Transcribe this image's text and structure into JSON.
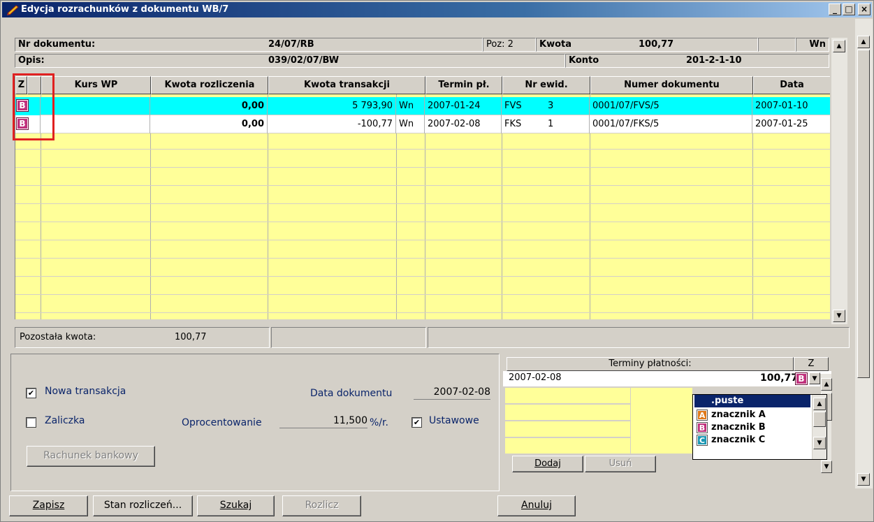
{
  "window": {
    "title": "Edycja rozrachunków z dokumentu WB/7",
    "controls": [
      "_",
      "□",
      "X"
    ]
  },
  "header": {
    "nr_label": "Nr dokumentu:",
    "nr_value": "24/07/RB",
    "poz": "Poz: 2",
    "kwota_label": "Kwota",
    "kwota_value": "100,77",
    "side": "Wn",
    "opis_label": "Opis:",
    "opis_value": "039/02/07/BW",
    "konto_label": "Konto",
    "konto_value": "201-2-1-10"
  },
  "table": {
    "columns": [
      "Z",
      "Kurs WP",
      "Kwota rozliczenia",
      "Kwota transakcji",
      "Termin pł.",
      "Nr ewid.",
      "Numer dokumentu",
      "Data"
    ],
    "rows": [
      {
        "mark": "B",
        "kurs": "",
        "kwota_rozl": "0,00",
        "kwota_tr": "5 793,90",
        "side": "Wn",
        "termin": "2007-01-24",
        "ewid_type": "FVS",
        "ewid_nr": "3",
        "numer": "0001/07/FVS/5",
        "data": "2007-01-10"
      },
      {
        "mark": "B",
        "kurs": "",
        "kwota_rozl": "0,00",
        "kwota_tr": "-100,77",
        "side": "Wn",
        "termin": "2007-02-08",
        "ewid_type": "FKS",
        "ewid_nr": "1",
        "numer": "0001/07/FKS/5",
        "data": "2007-01-25"
      }
    ]
  },
  "status": {
    "pozostala_label": "Pozostała kwota:",
    "pozostala_value": "100,77"
  },
  "form": {
    "nowa_transakcja": "Nowa transakcja",
    "nowa_checked": "✔",
    "zaliczka": "Zaliczka",
    "data_dok_label": "Data dokumentu",
    "data_dok_value": "2007-02-08",
    "oprocentowanie_label": "Oprocentowanie",
    "oprocentowanie_value": "11,500",
    "oprocentowanie_unit": "%/r.",
    "ustawowe": "Ustawowe",
    "ustawowe_checked": "✔",
    "rachunek": "Rachunek bankowy"
  },
  "terminy": {
    "header": "Terminy płatności:",
    "z": "Z",
    "date": "2007-02-08",
    "amount": "100,77",
    "mark": "B",
    "dodaj": "Dodaj",
    "usun": "Usuń"
  },
  "dropdown": {
    "items": [
      {
        "label": ".puste",
        "mark": ""
      },
      {
        "label": "znacznik A",
        "mark": "A",
        "color": "#e07a1c"
      },
      {
        "label": "znacznik B",
        "mark": "B",
        "color": "#c0307c"
      },
      {
        "label": "znacznik C",
        "mark": "C",
        "color": "#1c98b4"
      }
    ]
  },
  "buttons": {
    "zapisz": "Zapisz",
    "stan": "Stan rozliczeń...",
    "szukaj": "Szukaj",
    "rozlicz": "Rozlicz",
    "anuluj": "Anuluj"
  },
  "colors": {
    "selected_row": "#00ffff",
    "grid_bg": "#ffff99",
    "highlight": "#e02020"
  }
}
